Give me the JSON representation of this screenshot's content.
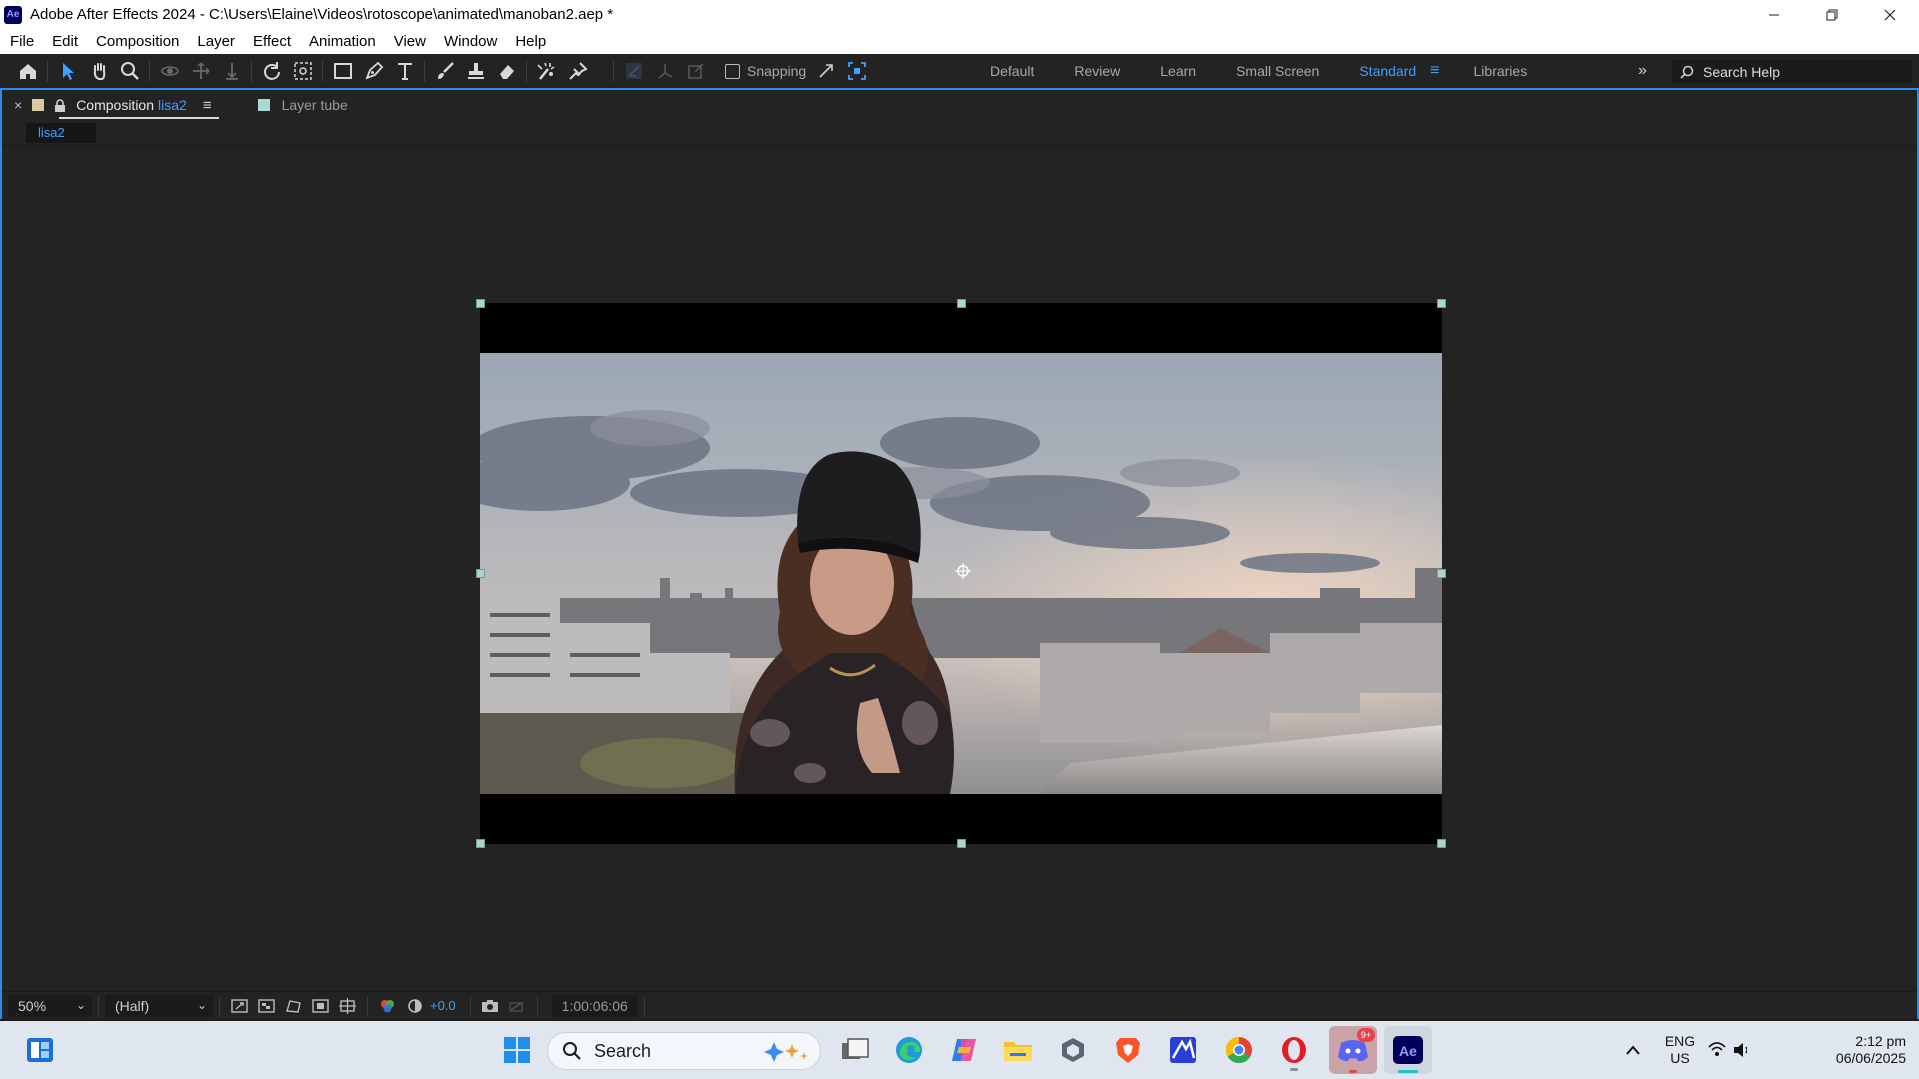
{
  "window": {
    "app_badge": "Ae",
    "title": "Adobe After Effects 2024 - C:\\Users\\Elaine\\Videos\\rotoscope\\animated\\manoban2.aep *"
  },
  "menu": [
    "File",
    "Edit",
    "Composition",
    "Layer",
    "Effect",
    "Animation",
    "View",
    "Window",
    "Help"
  ],
  "toolbar": {
    "snapping_label": "Snapping",
    "workspaces": [
      "Default",
      "Review",
      "Learn",
      "Small Screen"
    ],
    "active_workspace": "Standard",
    "libraries": "Libraries",
    "search_placeholder": "Search Help"
  },
  "panel": {
    "comp_tab_prefix": "Composition",
    "comp_tab_name": "lisa2",
    "layer_tab": "Layer  tube",
    "breadcrumb": "lisa2"
  },
  "viewer_controls": {
    "zoom": "50%",
    "resolution": "(Half)",
    "exposure": "+0.0",
    "timecode": "1:00:06:06"
  },
  "taskbar": {
    "search_label": "Search",
    "lang_line1": "ENG",
    "lang_line2": "US",
    "time": "2:12 pm",
    "date": "06/06/2025",
    "discord_badge": "9+"
  },
  "colors": {
    "accent": "#2d8ceb",
    "link_blue": "#3ea0ff",
    "panel_bg": "#232323",
    "handle": "#a9d6d3"
  }
}
